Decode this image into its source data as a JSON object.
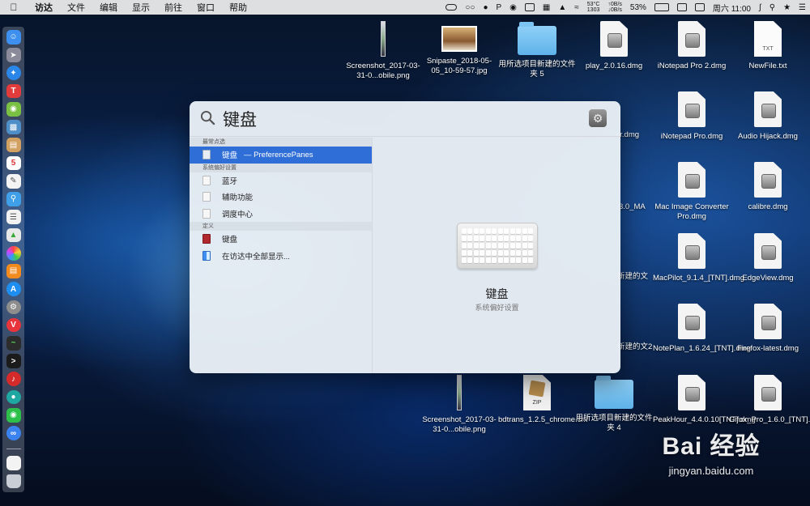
{
  "menubar": {
    "app_name": "访达",
    "menus": [
      "文件",
      "编辑",
      "显示",
      "前往",
      "窗口",
      "帮助"
    ],
    "temp": "53°C",
    "fan": "1303",
    "net_up": "0B/s",
    "net_down": "0B/s",
    "battery": "53%",
    "clock": "周六 11:00"
  },
  "dock": {
    "icons": [
      "finder-icon",
      "launchpad-icon",
      "safari-icon",
      "calendar-red-icon",
      "android-icon",
      "preview-icon",
      "notes-icon",
      "calendar-icon",
      "textedit-icon",
      "finder-search-icon",
      "list-icon",
      "photos-icon",
      "photos-color-icon",
      "books-icon",
      "app-store-icon",
      "system-preferences-icon",
      "vivaldi-icon",
      "activity-monitor-icon",
      "terminal-icon",
      "netease-music-icon",
      "green-app-icon",
      "wechat-icon",
      "baidu-disk-icon"
    ],
    "trailing": [
      "document-icon",
      "trash-icon"
    ]
  },
  "desktop": {
    "items": [
      {
        "label": "Screenshot_2017-03-31-0...obile.png",
        "kind": "strip"
      },
      {
        "label": "Snipaste_2018-05-05_10-59-57.jpg",
        "kind": "photo"
      },
      {
        "label": "用所选项目新建的文件夹 5",
        "kind": "folder"
      },
      {
        "label": "play_2.0.16.dmg",
        "kind": "dmg"
      },
      {
        "label": "iNotepad Pro 2.dmg",
        "kind": "dmg"
      },
      {
        "label": "NewFile.txt",
        "kind": "txt"
      },
      {
        "label": "er.dmg",
        "kind": "dmg"
      },
      {
        "label": "iNotepad Pro.dmg",
        "kind": "dmg"
      },
      {
        "label": "Audio Hijack.dmg",
        "kind": "dmg"
      },
      {
        "label": "3.0_MA",
        "kind": "dmg"
      },
      {
        "label": "Mac Image Converter Pro.dmg",
        "kind": "dmg"
      },
      {
        "label": "calibre.dmg",
        "kind": "dmg"
      },
      {
        "label": "新建的文",
        "kind": "folder"
      },
      {
        "label": "MacPilot_9.1.4_[TNT].dmg",
        "kind": "dmg"
      },
      {
        "label": "EdgeView.dmg",
        "kind": "dmg"
      },
      {
        "label": "新建的文2",
        "kind": "folder"
      },
      {
        "label": "NotePlan_1.6.24_[TNT].dmg",
        "kind": "dmg"
      },
      {
        "label": "Firefox-latest.dmg",
        "kind": "dmg"
      },
      {
        "label": "Screenshot_2017-03-31-0...obile.png",
        "kind": "strip"
      },
      {
        "label": "bdtrans_1.2.5_chrome.crx",
        "kind": "zip"
      },
      {
        "label": "用所选项目新建的文件夹 4",
        "kind": "folder"
      },
      {
        "label": "PeakHour_4.4.0.10[TNT].dmg",
        "kind": "dmg"
      },
      {
        "label": "Gifox_Pro_1.6.0_[TNT].dmg",
        "kind": "dmg"
      }
    ]
  },
  "spotlight": {
    "query": "键盘",
    "sections": [
      {
        "title": "最常点选",
        "rows": [
          {
            "label": "键盘",
            "sub": "— PreferencePanes",
            "selected": true
          }
        ]
      },
      {
        "title": "系统偏好设置",
        "rows": [
          {
            "label": "蓝牙"
          },
          {
            "label": "辅助功能"
          },
          {
            "label": "调度中心"
          }
        ]
      },
      {
        "title": "定义",
        "rows": [
          {
            "label": "键盘"
          },
          {
            "label": "在访达中全部显示..."
          }
        ]
      }
    ],
    "preview": {
      "title": "键盘",
      "subtitle": "系统偏好设置"
    }
  },
  "watermark": {
    "brand": "Bai 经验",
    "url": "jingyan.baidu.com"
  }
}
